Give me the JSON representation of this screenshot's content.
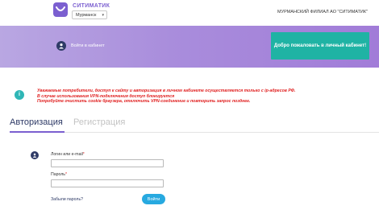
{
  "header": {
    "brand": "СИТИМАТИК",
    "city": "Мурманск",
    "branch": "МУРМАНСКИЙ ФИЛИАЛ АО \"СИТИМАТИК\""
  },
  "banner": {
    "login_link": "Войти в кабинет",
    "welcome_button": "Добро пожаловать в личный кабинет!"
  },
  "notice": {
    "icon": "info-icon",
    "lines": [
      "Уважаемые потребители, доступ к сайту и авторизация в личном кабинете осуществляется только с ip-адресов РФ.",
      "В случае использования VPN-подключения доступ блокируется",
      "Попробуйте очистить cookie браузера, отключить VPN-соединение и повторить запрос позднее."
    ]
  },
  "tabs": [
    {
      "label": "Авторизация",
      "active": true
    },
    {
      "label": "Регистрация",
      "active": false
    }
  ],
  "form": {
    "login_label": "Логин или e-mail",
    "password_label": "Пароль",
    "required_mark": "*",
    "login_value": "",
    "password_value": "",
    "forgot_link": "Забыли пароль?",
    "submit": "Войти"
  },
  "colors": {
    "accent": "#7b5fd0",
    "banner_start": "#b9a7e2",
    "banner_end": "#a17cd8",
    "welcome_button": "#1fb3a4",
    "notice_text": "#e02020",
    "submit_button": "#27a9e0",
    "dark_navy": "#2e3a66"
  }
}
